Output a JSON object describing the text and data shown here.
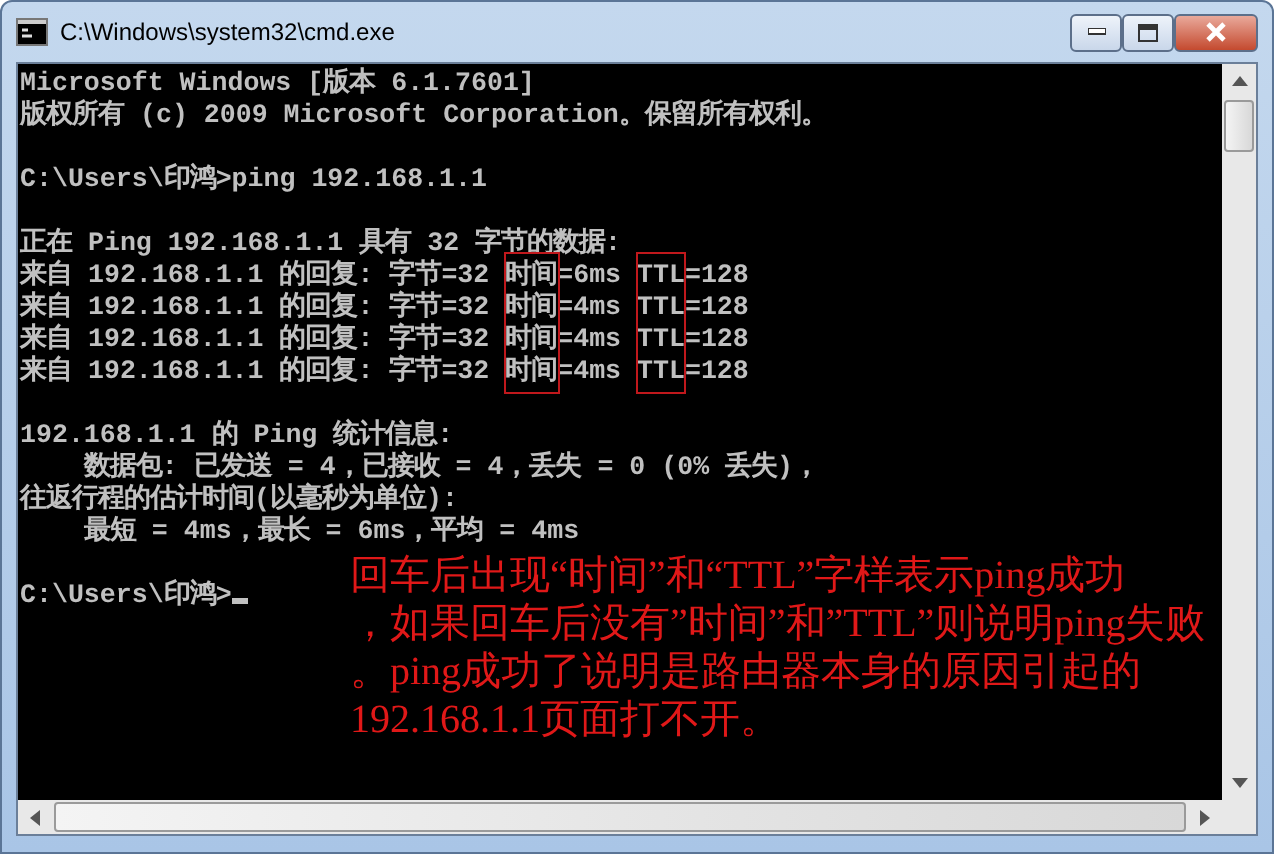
{
  "window": {
    "title": "C:\\Windows\\system32\\cmd.exe"
  },
  "console": {
    "lines": [
      {
        "kind": "text",
        "text": "Microsoft Windows [版本 6.1.7601]"
      },
      {
        "kind": "text",
        "text": "版权所有 (c) 2009 Microsoft Corporation。保留所有权利。"
      },
      {
        "kind": "blank"
      },
      {
        "kind": "text",
        "text": "C:\\Users\\印鸿>ping 192.168.1.1"
      },
      {
        "kind": "blank"
      },
      {
        "kind": "text",
        "text": "正在 Ping 192.168.1.1 具有 32 字节的数据:"
      },
      {
        "kind": "reply",
        "parts": [
          {
            "text": "来自 192.168.1.1 的回复: 字节=32 "
          },
          {
            "text": "时间",
            "boxed": true
          },
          {
            "text": "=6ms "
          },
          {
            "text": "TTL",
            "boxed": true
          },
          {
            "text": "=128"
          }
        ]
      },
      {
        "kind": "reply",
        "parts": [
          {
            "text": "来自 192.168.1.1 的回复: 字节=32 "
          },
          {
            "text": "时间",
            "boxed": true
          },
          {
            "text": "=4ms "
          },
          {
            "text": "TTL",
            "boxed": true
          },
          {
            "text": "=128"
          }
        ]
      },
      {
        "kind": "reply",
        "parts": [
          {
            "text": "来自 192.168.1.1 的回复: 字节=32 "
          },
          {
            "text": "时间",
            "boxed": true
          },
          {
            "text": "=4ms "
          },
          {
            "text": "TTL",
            "boxed": true
          },
          {
            "text": "=128"
          }
        ]
      },
      {
        "kind": "reply",
        "parts": [
          {
            "text": "来自 192.168.1.1 的回复: 字节=32 "
          },
          {
            "text": "时间",
            "boxed": true
          },
          {
            "text": "=4ms "
          },
          {
            "text": "TTL",
            "boxed": true
          },
          {
            "text": "=128"
          }
        ]
      },
      {
        "kind": "blank"
      },
      {
        "kind": "text",
        "text": "192.168.1.1 的 Ping 统计信息:"
      },
      {
        "kind": "text",
        "text": "    数据包: 已发送 = 4，已接收 = 4，丢失 = 0 (0% 丢失)，"
      },
      {
        "kind": "text",
        "text": "往返行程的估计时间(以毫秒为单位):"
      },
      {
        "kind": "text",
        "text": "    最短 = 4ms，最长 = 6ms，平均 = 4ms"
      },
      {
        "kind": "blank"
      },
      {
        "kind": "prompt",
        "text": "C:\\Users\\印鸿>",
        "cursor": true
      }
    ]
  },
  "annotation": {
    "lines": [
      "回车后出现“时间”和“TTL”字样表示ping成功",
      "，如果回车后没有”时间”和”TTL”则说明ping失败",
      "。ping成功了说明是路由器本身的原因引起的",
      "192.168.1.1页面打不开。"
    ]
  }
}
